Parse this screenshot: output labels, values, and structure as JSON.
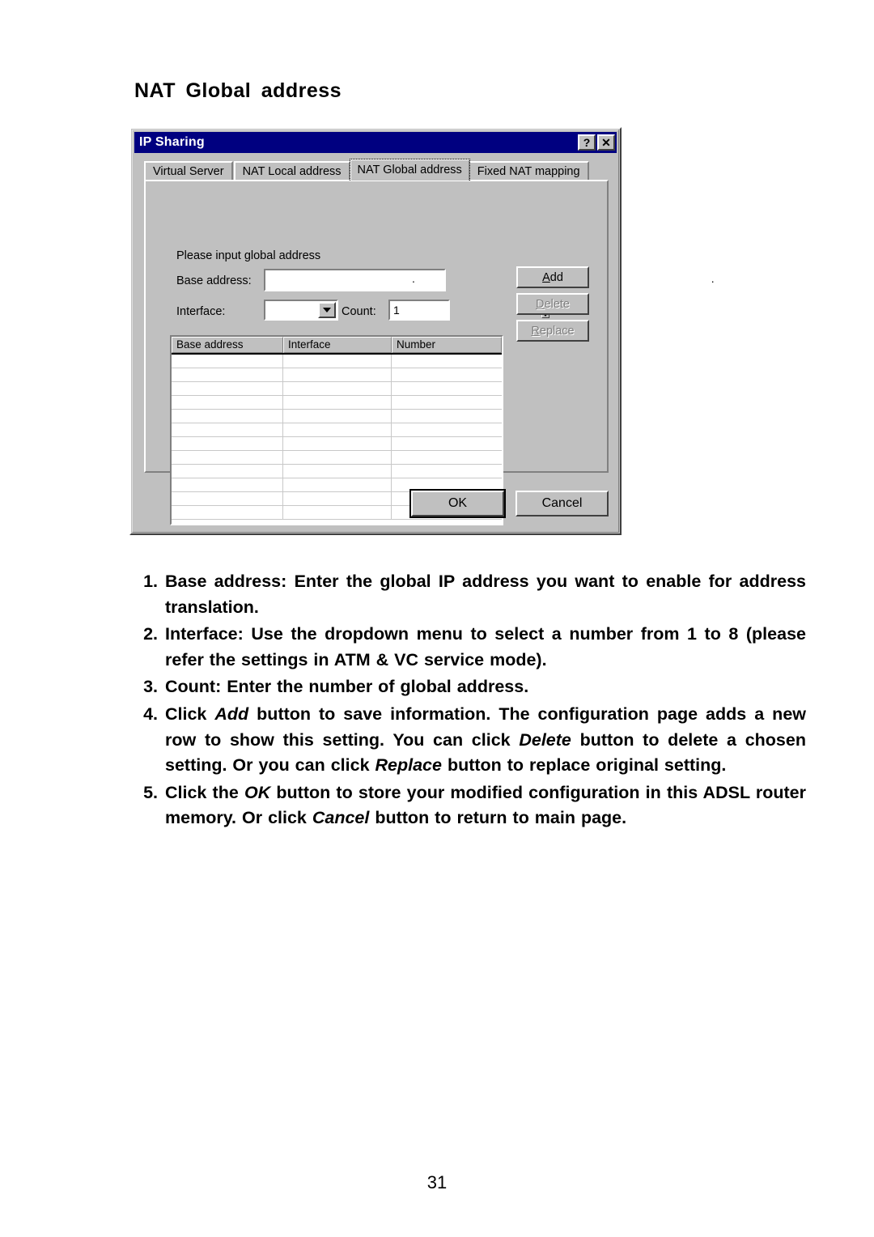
{
  "page": {
    "heading": "NAT  Global  address",
    "number": "31"
  },
  "dialog": {
    "title": "IP Sharing",
    "titlebar_buttons": [
      {
        "name": "help-button",
        "glyph": "?"
      },
      {
        "name": "close-button",
        "glyph": "✕"
      }
    ],
    "tabs": [
      {
        "label": "Virtual Server",
        "active": false
      },
      {
        "label": "NAT Local address",
        "active": false
      },
      {
        "label": "NAT Global address",
        "active": true
      },
      {
        "label": "Fixed NAT mapping",
        "active": false
      }
    ],
    "form": {
      "hint": "Please input global address",
      "base_address_label": "Base address:",
      "base_address_octets": [
        "",
        "",
        "",
        ""
      ],
      "base_address_separator": ".",
      "interface_label": "Interface:",
      "interface_value": "",
      "count_label": "Count:",
      "count_value": "1"
    },
    "side_buttons": [
      {
        "label": "Add",
        "accel": "A",
        "enabled": true
      },
      {
        "label": "Delete",
        "accel": "D",
        "enabled": false
      },
      {
        "label": "Replace",
        "accel": "R",
        "enabled": false
      }
    ],
    "table": {
      "columns": [
        "Base address",
        "Interface",
        "Number"
      ],
      "rows": [
        [
          "",
          "",
          ""
        ],
        [
          "",
          "",
          ""
        ],
        [
          "",
          "",
          ""
        ],
        [
          "",
          "",
          ""
        ],
        [
          "",
          "",
          ""
        ],
        [
          "",
          "",
          ""
        ],
        [
          "",
          "",
          ""
        ],
        [
          "",
          "",
          ""
        ],
        [
          "",
          "",
          ""
        ],
        [
          "",
          "",
          ""
        ],
        [
          "",
          "",
          ""
        ],
        [
          "",
          "",
          ""
        ]
      ]
    },
    "footer_buttons": [
      {
        "label": "OK",
        "default": true
      },
      {
        "label": "Cancel",
        "default": false
      }
    ]
  },
  "instructions": [
    {
      "number": "1.",
      "parts": [
        {
          "text": "Base address: Enter the global IP address you want to enable for  address  translation.",
          "italic": false
        }
      ]
    },
    {
      "number": "2.",
      "parts": [
        {
          "text": "Interface: Use the dropdown menu to select a number from 1 to 8 (please refer the settings in ATM & VC service mode).",
          "italic": false
        }
      ]
    },
    {
      "number": "3.",
      "parts": [
        {
          "text": "Count: Enter the number of global address.",
          "italic": false
        }
      ]
    },
    {
      "number": "4.",
      "parts": [
        {
          "text": "Click ",
          "italic": false
        },
        {
          "text": "Add",
          "italic": true
        },
        {
          "text": " button to save information.  The configuration page adds a new row to show this setting.  You can click ",
          "italic": false
        },
        {
          "text": "Delete",
          "italic": true
        },
        {
          "text": " button to delete a chosen setting.  Or you can click ",
          "italic": false
        },
        {
          "text": "Replace",
          "italic": true
        },
        {
          "text": " button to replace original setting.",
          "italic": false
        }
      ]
    },
    {
      "number": "5.",
      "parts": [
        {
          "text": "Click the ",
          "italic": false
        },
        {
          "text": "OK",
          "italic": true
        },
        {
          "text": " button to store your modified configuration in this ADSL router memory.  Or click ",
          "italic": false
        },
        {
          "text": "Cancel",
          "italic": true
        },
        {
          "text": " button to return to main page.",
          "italic": false
        }
      ]
    }
  ],
  "colors": {
    "titlebar": "#000080",
    "dialog_face": "#c0c0c0",
    "field_bg": "#ffffff",
    "disabled_text": "#808080"
  }
}
